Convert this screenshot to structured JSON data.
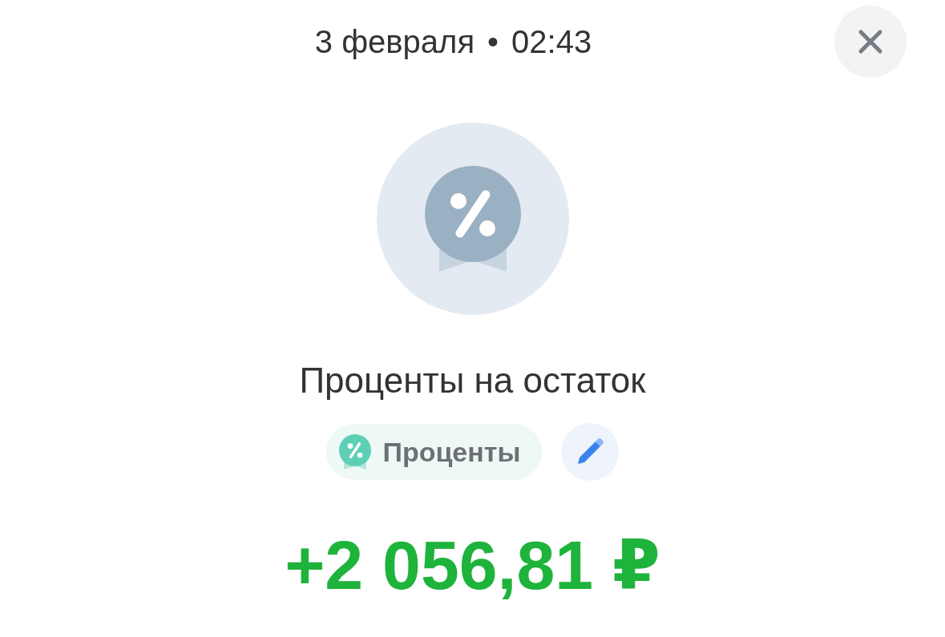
{
  "header": {
    "date": "3 февраля",
    "separator": "•",
    "time": "02:43"
  },
  "title": "Проценты на остаток",
  "category": {
    "label": "Проценты"
  },
  "amount": {
    "text": "+2 056,81 ₽",
    "kind": "income"
  }
}
